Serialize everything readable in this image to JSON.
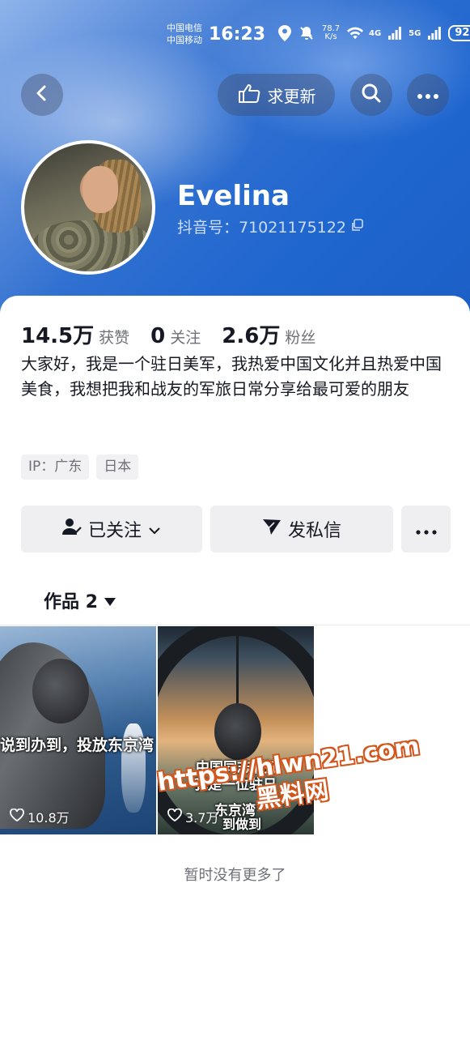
{
  "status_bar": {
    "carrier_1": "中国电信",
    "carrier_2": "中国移动",
    "time": "16:23",
    "speed_value": "78.7",
    "speed_unit": "K/s",
    "net_1": "4G",
    "net_2": "5G",
    "battery": "92"
  },
  "header": {
    "update_button_label": "求更新",
    "colors": {
      "accent_blue": "#1f66cf"
    }
  },
  "profile": {
    "name": "Evelina",
    "douyin_id": "抖音号：71021175122"
  },
  "stats": [
    {
      "num": "14.5万",
      "label": "获赞"
    },
    {
      "num": "0",
      "label": "关注"
    },
    {
      "num": "2.6万",
      "label": "粉丝"
    }
  ],
  "bio": "大家好，我是一个驻日美军，我热爱中国文化并且热爱中国美食，我想把我和战友的军旅日常分享给最可爱的朋友",
  "tags": [
    "IP：广东",
    "日本"
  ],
  "actions": {
    "follow_label": "已关注",
    "message_label": "发私信"
  },
  "works_tab": {
    "label": "作品 2"
  },
  "videos": [
    {
      "overlay_text": "说到办到，投放东京湾",
      "likes": "10.8万"
    },
    {
      "overlay_line1": "中国同志们好",
      "overlay_line2": "我是一位驻日",
      "overlay_line3": "东京湾",
      "overlay_line4": "到做到",
      "likes": "3.7万"
    }
  ],
  "watermark": {
    "line1": "https://hlwn21.com",
    "line2": "黑料网"
  },
  "footer_text": "暂时没有更多了"
}
